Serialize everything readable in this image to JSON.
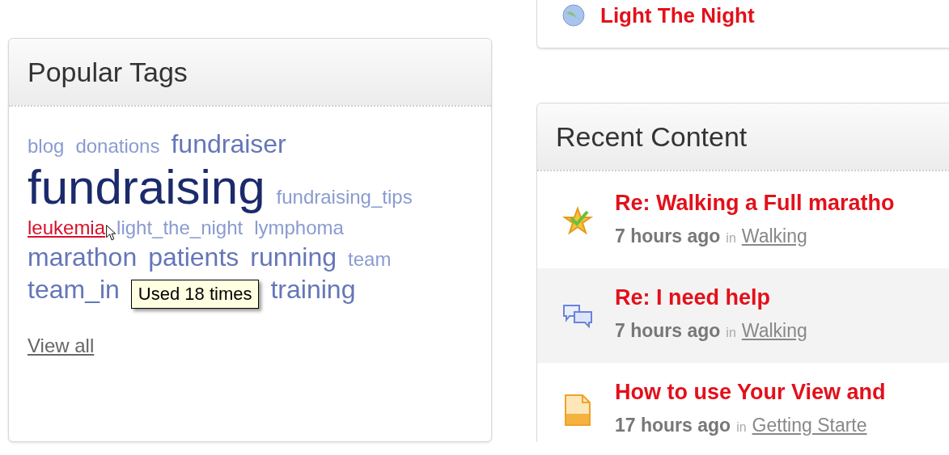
{
  "top_card": {
    "title": "Light The Night"
  },
  "popular_tags": {
    "title": "Popular Tags",
    "tag_rows": [
      [
        {
          "text": "blog",
          "kind": "small",
          "hovered": false
        },
        {
          "text": "donations",
          "kind": "small",
          "hovered": false
        },
        {
          "text": "fundraiser",
          "kind": "medium",
          "hovered": false
        }
      ],
      [
        {
          "text": "fundraising",
          "kind": "xlarge",
          "hovered": false
        },
        {
          "text": "fundraising_tips",
          "kind": "small",
          "hovered": false
        }
      ],
      [
        {
          "text": "leukemia",
          "kind": "small",
          "hovered": true
        },
        {
          "text": "light_the_night",
          "kind": "small",
          "hovered": false
        },
        {
          "text": "lymphoma",
          "kind": "small",
          "hovered": false
        }
      ],
      [
        {
          "text": "marathon",
          "kind": "medium",
          "hovered": false
        },
        {
          "text": "patients",
          "kind": "medium",
          "hovered": false
        },
        {
          "text": "running",
          "kind": "medium",
          "hovered": false
        },
        {
          "text": "team",
          "kind": "small",
          "hovered": false
        }
      ],
      [
        {
          "text": "team_in",
          "kind": "medium",
          "hovered": false
        },
        {
          "kind": "tooltip",
          "text": "Used 18 times"
        },
        {
          "text": "training",
          "kind": "medium",
          "hovered": false
        }
      ]
    ],
    "view_all": "View all"
  },
  "recent_content": {
    "title": "Recent Content",
    "items": [
      {
        "kind": "star",
        "title": "Re: Walking a Full maratho",
        "time": "7 hours ago",
        "in": "in",
        "place": "Walking",
        "selected": false
      },
      {
        "kind": "discussion",
        "title": "Re: I need help",
        "time": "7 hours ago",
        "in": "in",
        "place": "Walking",
        "selected": true
      },
      {
        "kind": "document",
        "title": "How to use Your View and",
        "time": "17 hours ago",
        "in": "in",
        "place": "Getting Starte",
        "selected": false
      }
    ]
  }
}
